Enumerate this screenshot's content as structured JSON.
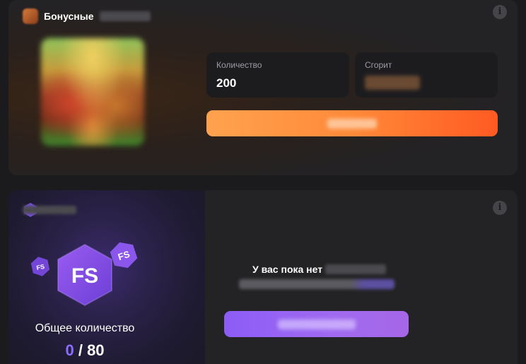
{
  "bonus_card": {
    "title": "Бонусные",
    "quantity_label": "Количество",
    "quantity_value": "200",
    "burn_label": "Сгорит",
    "button_gradient": [
      "#ffa24f",
      "#ff5a22"
    ]
  },
  "freespins_card": {
    "badge_text": "FS",
    "hex_label": "FS",
    "total_label": "Общее количество",
    "current_count": "0",
    "separator": "/",
    "total_count": "80",
    "empty_title": "У вас пока нет",
    "accent_color": "#8b6dff",
    "button_gradient": [
      "#8c5cf6",
      "#a666e8"
    ]
  },
  "icons": {
    "info": "info-icon",
    "bonus_game": "bonus-game-icon",
    "freespins": "fs-badge-icon"
  }
}
